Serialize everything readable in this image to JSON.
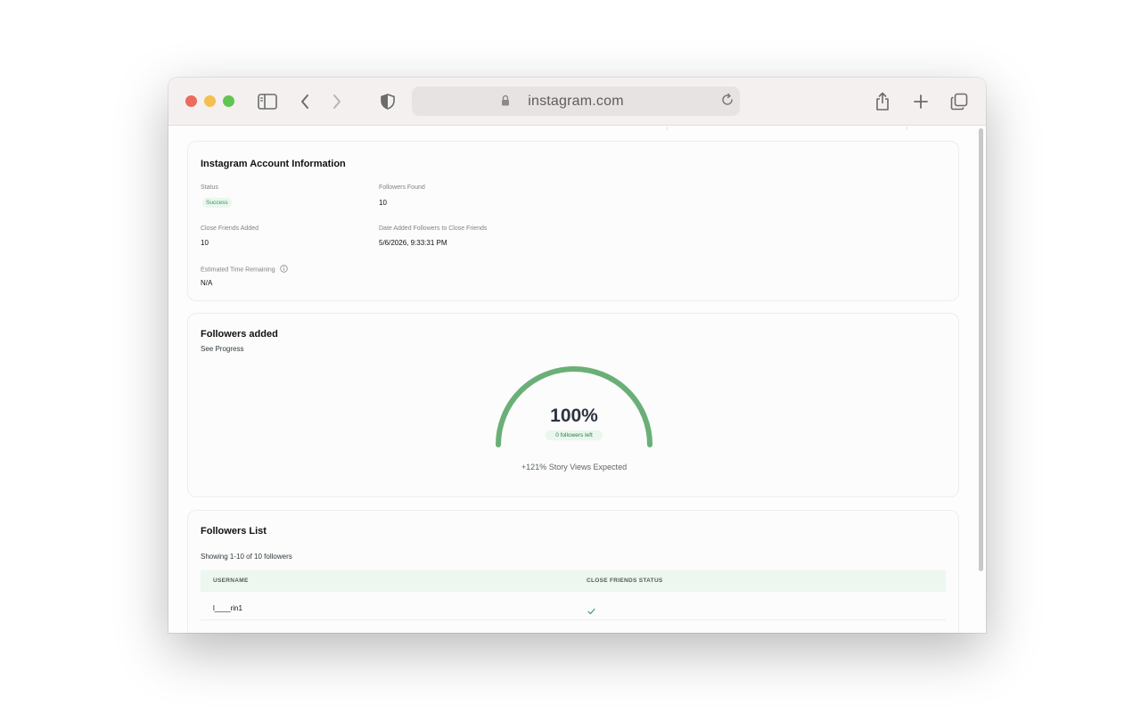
{
  "browser": {
    "url": "instagram.com"
  },
  "account_card": {
    "title": "Instagram Account Information",
    "status_label": "Status",
    "status_value": "Success",
    "followers_found_label": "Followers Found",
    "followers_found_value": "10",
    "close_friends_label": "Close Friends Added",
    "close_friends_value": "10",
    "date_label": "Date Added Followers to Close Friends",
    "date_value": "5/6/2026, 9:33:31 PM",
    "eta_label": "Estimated Time Remaining",
    "eta_value": "N/A"
  },
  "progress_card": {
    "title": "Followers added",
    "subtitle": "See Progress",
    "percent_text": "100%",
    "progress_fraction": 1.0,
    "followers_left": "0 followers left",
    "story_views": "+121% Story Views Expected"
  },
  "list_card": {
    "title": "Followers List",
    "showing": "Showing 1-10 of 10 followers",
    "columns": [
      "USERNAME",
      "CLOSE FRIENDS STATUS"
    ],
    "rows": [
      {
        "username": "l____rin1",
        "status_icon": "check-icon"
      }
    ]
  },
  "colors": {
    "gauge": "#6aaf77",
    "success": "#2f9a55",
    "table_header": "#edf7ef"
  },
  "icons": [
    "sidebar-icon",
    "back-icon",
    "forward-icon",
    "shield-icon",
    "lock-icon",
    "reload-icon",
    "share-icon",
    "plus-icon",
    "tabs-icon",
    "info-icon",
    "check-icon"
  ]
}
